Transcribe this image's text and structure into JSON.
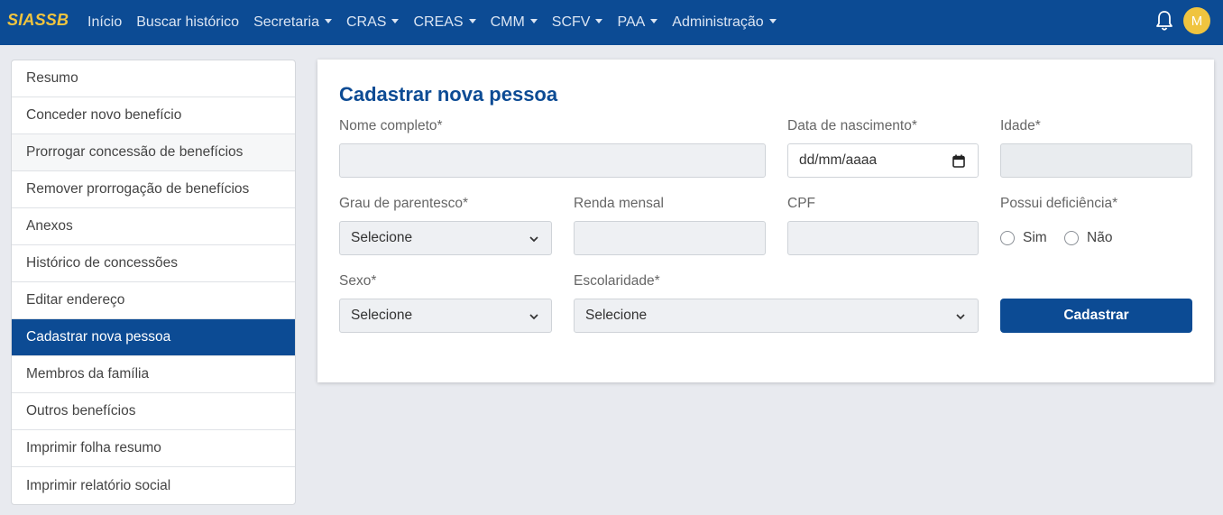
{
  "navbar": {
    "brand": "SIASSB",
    "items": [
      {
        "label": "Início",
        "dropdown": false
      },
      {
        "label": "Buscar histórico",
        "dropdown": false
      },
      {
        "label": "Secretaria",
        "dropdown": true
      },
      {
        "label": "CRAS",
        "dropdown": true
      },
      {
        "label": "CREAS",
        "dropdown": true
      },
      {
        "label": "CMM",
        "dropdown": true
      },
      {
        "label": "SCFV",
        "dropdown": true
      },
      {
        "label": "PAA",
        "dropdown": true
      },
      {
        "label": "Administração",
        "dropdown": true
      }
    ],
    "avatar_initial": "M",
    "bell_icon": "bell-icon"
  },
  "sidebar": {
    "items": [
      {
        "label": "Resumo"
      },
      {
        "label": "Conceder novo benefício"
      },
      {
        "label": "Prorrogar concessão de benefícios"
      },
      {
        "label": "Remover prorrogação de benefícios"
      },
      {
        "label": "Anexos"
      },
      {
        "label": "Histórico de concessões"
      },
      {
        "label": "Editar endereço"
      },
      {
        "label": "Cadastrar nova pessoa"
      },
      {
        "label": "Membros da família"
      },
      {
        "label": "Outros benefícios"
      },
      {
        "label": "Imprimir folha resumo"
      },
      {
        "label": "Imprimir relatório social"
      }
    ],
    "active_index": 7
  },
  "form": {
    "title": "Cadastrar nova pessoa",
    "nome_label": "Nome completo*",
    "nome_value": "",
    "data_label": "Data de nascimento*",
    "data_placeholder": "dd/mm/aaaa",
    "idade_label": "Idade*",
    "idade_value": "",
    "grau_label": "Grau de parentesco*",
    "grau_value": "Selecione",
    "renda_label": "Renda mensal",
    "renda_value": "",
    "cpf_label": "CPF",
    "cpf_value": "",
    "deficiencia_label": "Possui deficiência*",
    "radio_sim": "Sim",
    "radio_nao": "Não",
    "sexo_label": "Sexo*",
    "sexo_value": "Selecione",
    "escolaridade_label": "Escolaridade*",
    "escolaridade_value": "Selecione",
    "submit_label": "Cadastrar"
  },
  "colors": {
    "primary": "#0c4b94",
    "brand_accent": "#f0c43f",
    "background": "#e8eaef"
  }
}
